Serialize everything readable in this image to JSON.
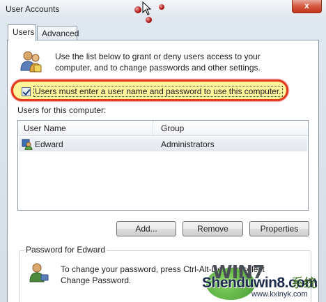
{
  "window": {
    "title": "User Accounts",
    "close_label": "x"
  },
  "tabs": [
    {
      "label": "Users",
      "active": true
    },
    {
      "label": "Advanced",
      "active": false
    }
  ],
  "users_tab": {
    "info_text": "Use the list below to grant or deny users access to your computer, and to change passwords and other settings.",
    "checkbox": {
      "label": "Users must enter a user name and password to use this computer.",
      "checked": true
    },
    "list_label": "Users for this computer:",
    "columns": [
      "User Name",
      "Group"
    ],
    "rows": [
      {
        "user": "Edward",
        "group": "Administrators"
      }
    ],
    "buttons": {
      "add": "Add...",
      "remove": "Remove",
      "properties": "Properties"
    },
    "password_group": {
      "title": "Password for Edward",
      "text": "To change your password, press Ctrl-Alt-Del and select Change Password."
    }
  },
  "watermark": {
    "logo": "WIN7",
    "site": "Shenduwin8.com",
    "cn": "系统",
    "url": "www.kxinyk.com"
  },
  "colors": {
    "highlight_fill": "#fff49a",
    "highlight_border": "#e2391b",
    "close_button": "#c3351e"
  }
}
